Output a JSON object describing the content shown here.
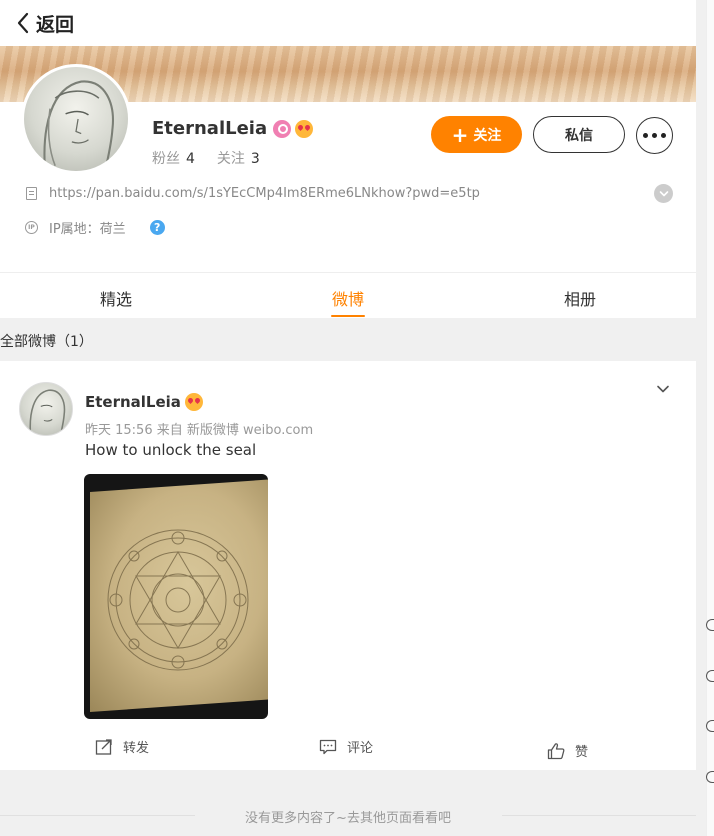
{
  "header": {
    "back_label": "返回"
  },
  "profile": {
    "name": "EternalLeia",
    "fans_label": "粉丝",
    "fans_count": "4",
    "following_label": "关注",
    "following_count": "3",
    "follow_button": "关注",
    "message_button": "私信",
    "link": "https://pan.baidu.com/s/1sYEcCMp4Im8ERme6LNkhow?pwd=e5tp",
    "ip_location": "IP属地：荷兰"
  },
  "tabs": [
    {
      "label": "精选",
      "active": false
    },
    {
      "label": "微博",
      "active": true
    },
    {
      "label": "相册",
      "active": false
    }
  ],
  "section": {
    "title": "全部微博（1）"
  },
  "post": {
    "author": "EternalLeia",
    "meta": "昨天 15:56  来自 新版微博 weibo.com",
    "text": "How to unlock the seal",
    "actions": {
      "repost": "转发",
      "comment": "评论",
      "like": "赞"
    }
  },
  "footer": {
    "text": "没有更多内容了~去其他页面看看吧"
  },
  "colors": {
    "accent": "#ff8200",
    "help_blue": "#4aa8f0",
    "vip_pink": "#f07fb2"
  }
}
